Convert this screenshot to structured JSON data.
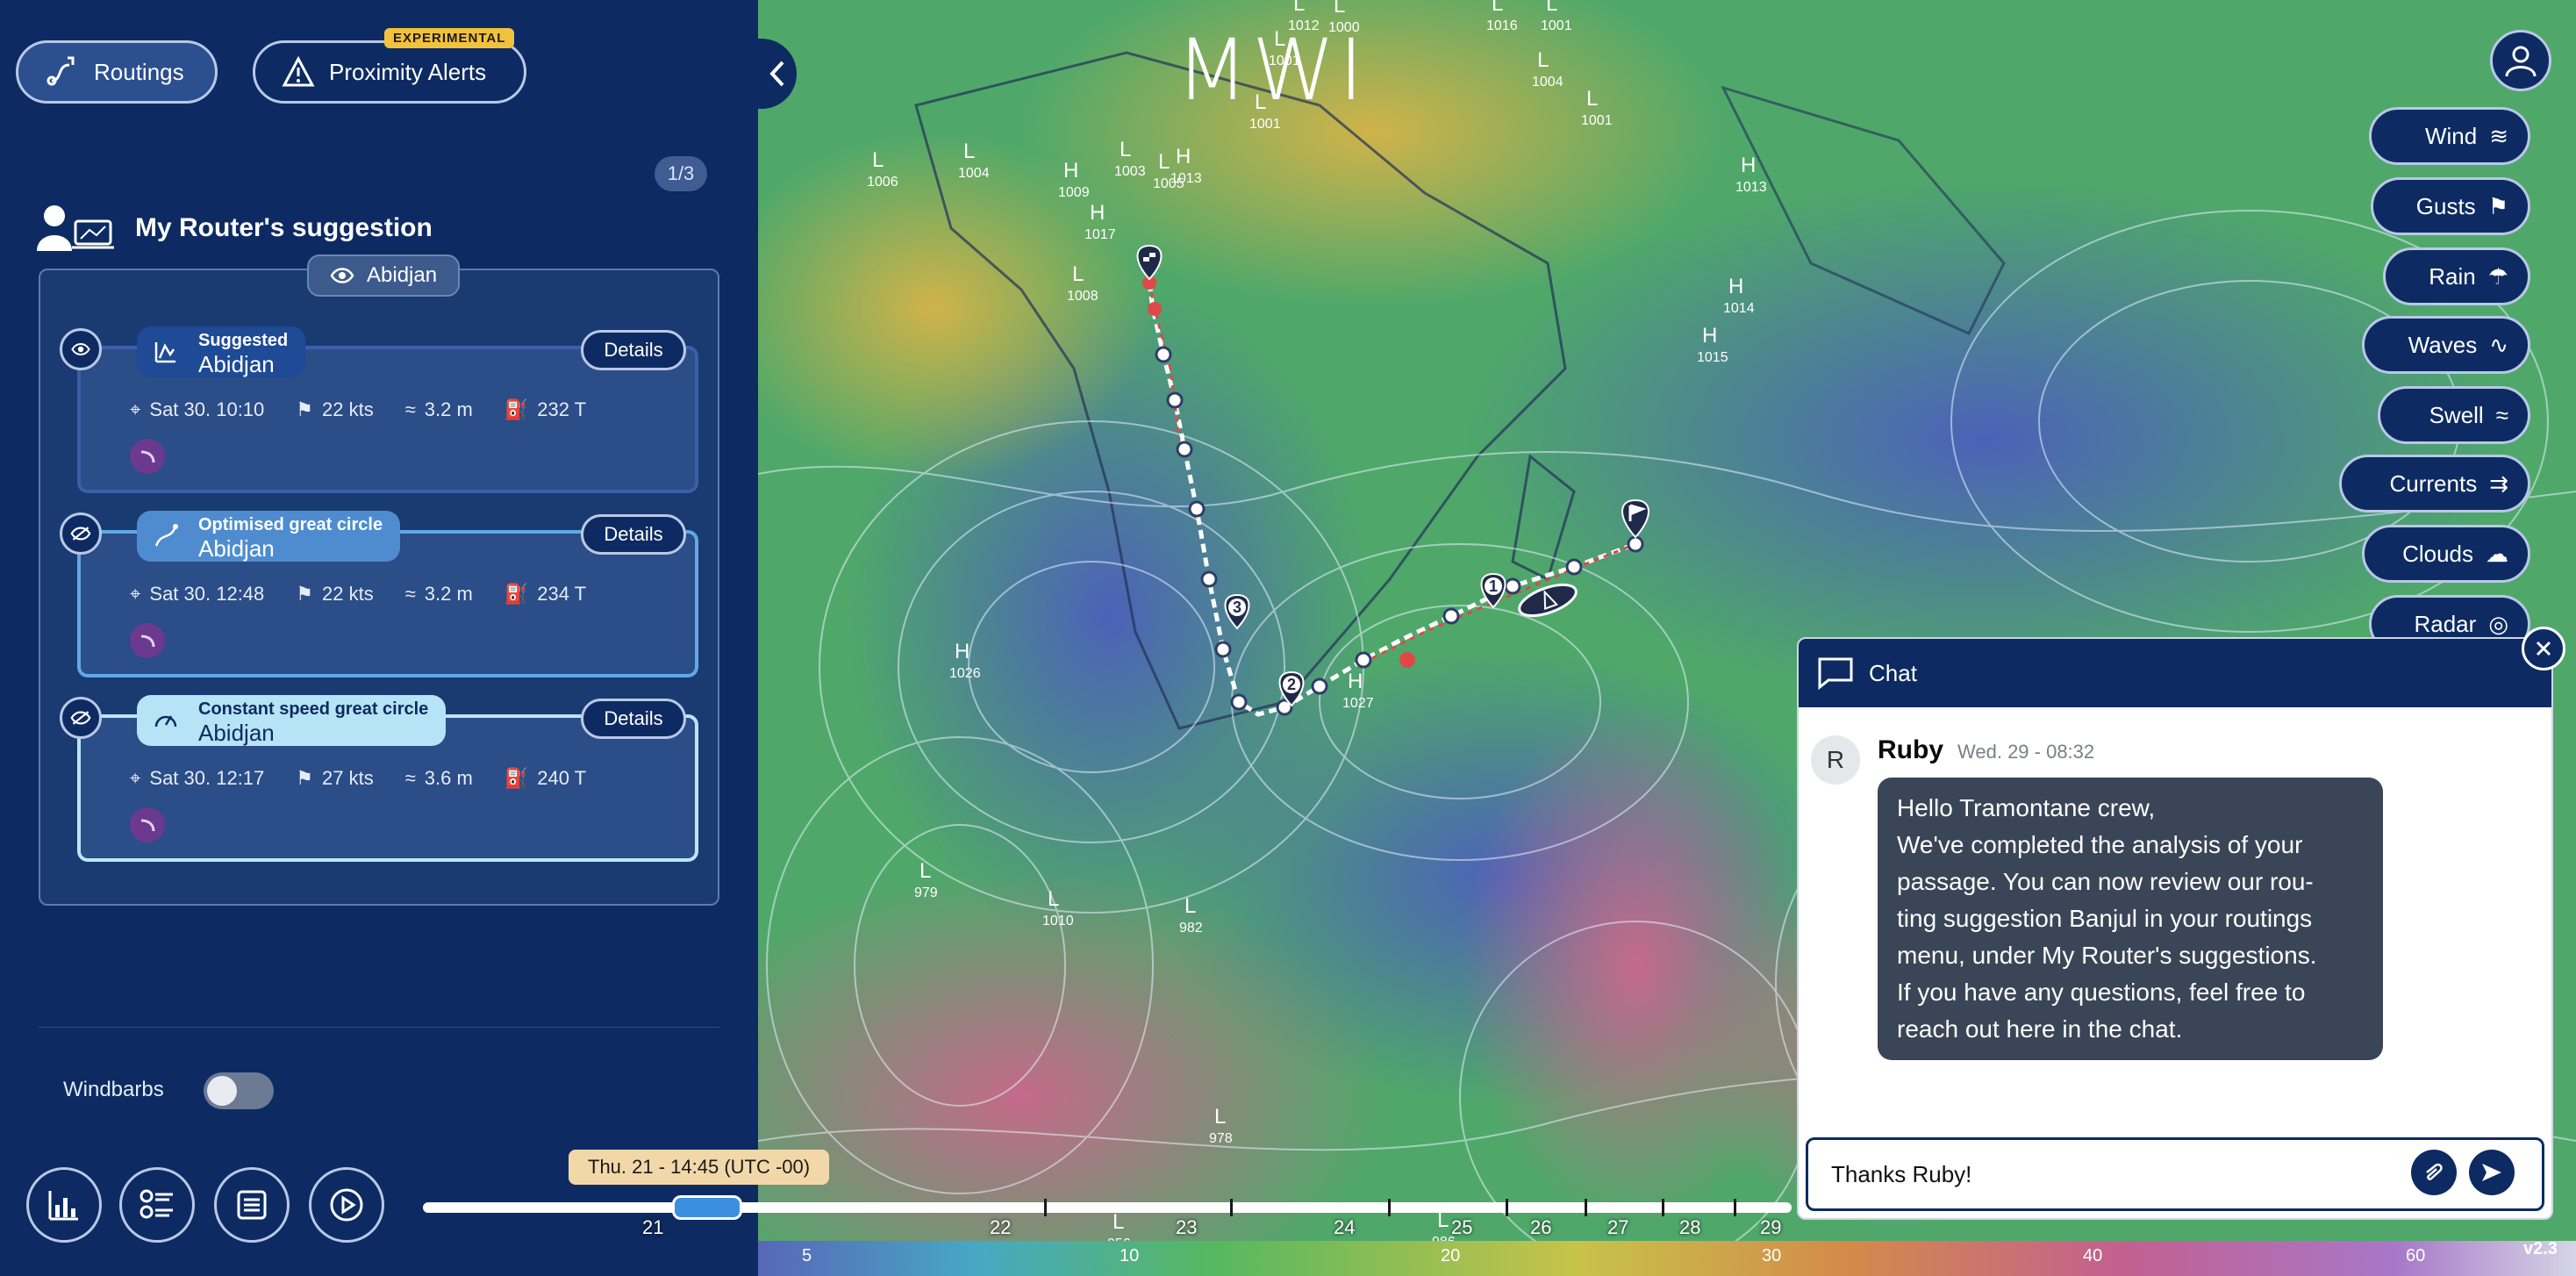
{
  "sidebar": {
    "routings_label": "Routings",
    "proximity_label": "Proximity Alerts",
    "experimental_badge": "EXPERIMENTAL",
    "pager": "1/3",
    "section_title": "My Router's suggestion",
    "group_label": "Abidjan",
    "routes": [
      {
        "type": "Suggested",
        "name": "Abidjan",
        "details": "Details",
        "eta": "Sat 30. 10:10",
        "wind": "22 kts",
        "waves": "3.2 m",
        "heading": "232 T"
      },
      {
        "type": "Optimised great circle",
        "name": "Abidjan",
        "details": "Details",
        "eta": "Sat 30. 12:48",
        "wind": "22 kts",
        "waves": "3.2 m",
        "heading": "234 T"
      },
      {
        "type": "Constant speed great circle",
        "name": "Abidjan",
        "details": "Details",
        "eta": "Sat 30. 12:17",
        "wind": "27 kts",
        "waves": "3.6 m",
        "heading": "240 T"
      }
    ],
    "windbarbs_label": "Windbarbs",
    "windbarbs_on": false
  },
  "map": {
    "logo": "MWI",
    "layers": [
      "Wind",
      "Gusts",
      "Rain",
      "Waves",
      "Swell",
      "Currents",
      "Clouds",
      "Radar"
    ],
    "pressure_labels": [
      {
        "t": "L",
        "v": "1006"
      },
      {
        "t": "L",
        "v": "1004"
      },
      {
        "t": "H",
        "v": "1009"
      },
      {
        "t": "L",
        "v": "1003"
      },
      {
        "t": "L",
        "v": "1005"
      },
      {
        "t": "H",
        "v": "1013"
      },
      {
        "t": "L",
        "v": "1001"
      },
      {
        "t": "L",
        "v": "1012"
      },
      {
        "t": "L",
        "v": "1000"
      },
      {
        "t": "L",
        "v": "1001"
      },
      {
        "t": "L",
        "v": "1016"
      },
      {
        "t": "L",
        "v": "1001"
      },
      {
        "t": "L",
        "v": "1004"
      },
      {
        "t": "L",
        "v": "1001"
      },
      {
        "t": "H",
        "v": "1013"
      },
      {
        "t": "H",
        "v": "1014"
      },
      {
        "t": "H",
        "v": "1015"
      },
      {
        "t": "H",
        "v": "1017"
      },
      {
        "t": "L",
        "v": "1008"
      },
      {
        "t": "H",
        "v": "1026"
      },
      {
        "t": "H",
        "v": "1027"
      },
      {
        "t": "L",
        "v": "979"
      },
      {
        "t": "L",
        "v": "1010"
      },
      {
        "t": "L",
        "v": "982"
      },
      {
        "t": "L",
        "v": "978"
      },
      {
        "t": "L",
        "v": "956"
      },
      {
        "t": "L",
        "v": "986"
      }
    ],
    "waypoints": [
      "3",
      "2",
      "1"
    ],
    "time_label": "Thu. 21 - 14:45 (UTC -00)",
    "timeline_days": [
      "21",
      "22",
      "23",
      "24",
      "25",
      "26",
      "27",
      "28",
      "29"
    ],
    "scale_values": [
      "5",
      "10",
      "20",
      "30",
      "40",
      "60"
    ],
    "version": "v2.3"
  },
  "chat": {
    "title": "Chat",
    "sender_initial": "R",
    "sender": "Ruby",
    "time": "Wed. 29 - 08:32",
    "message_lines": [
      "Hello Tramontane crew,",
      "We've completed the analysis of your",
      "passage. You can now review our rou-",
      "ting suggestion Banjul in your routings",
      "menu, under My Router's suggestions.",
      "If you have any questions, feel free to",
      "reach out here in the chat."
    ],
    "input_value": "Thanks Ruby!"
  },
  "colors": {
    "navy": "#0d2b62",
    "accent": "#3c8fe0",
    "badge": "#f3c23b"
  }
}
